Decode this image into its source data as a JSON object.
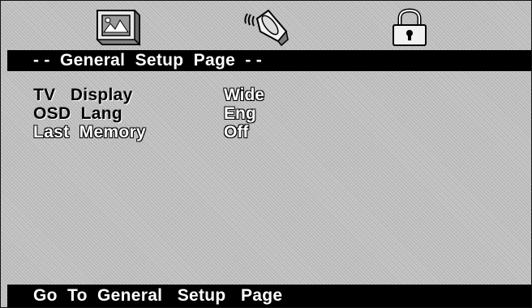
{
  "tabs": [
    {
      "name": "general",
      "icon": "monitor-icon"
    },
    {
      "name": "audio",
      "icon": "speaker-icon"
    },
    {
      "name": "lock",
      "icon": "lock-icon"
    }
  ],
  "header": {
    "title": "- -  General  Setup  Page  - -"
  },
  "settings": [
    {
      "label": "TV   Display",
      "value": "Wide"
    },
    {
      "label": "OSD  Lang",
      "value": "Eng"
    },
    {
      "label": "Last  Memory",
      "value": "Off"
    }
  ],
  "footer": {
    "status": "Go  To  General   Setup   Page"
  },
  "colors": {
    "background": "#c4c4c4",
    "bar": "#000000",
    "bar_text": "#ffffff"
  }
}
